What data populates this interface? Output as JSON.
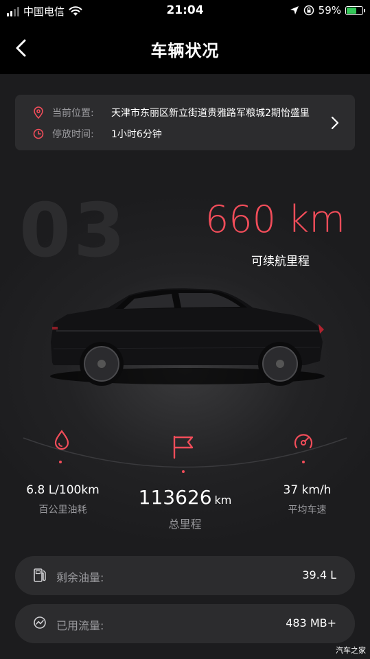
{
  "status_bar": {
    "carrier": "中国电信",
    "time": "21:04",
    "battery": "59%"
  },
  "nav": {
    "title": "车辆状况"
  },
  "location": {
    "position_label": "当前位置:",
    "position_value": "天津市东丽区新立街道贵雅路军粮城2期怡盛里",
    "parked_label": "停放时间:",
    "parked_value": "1小时6分钟"
  },
  "vehicle": {
    "model_watermark": "03",
    "range_value": "660 km",
    "range_label": "可续航里程"
  },
  "stats": {
    "fuel_consumption": {
      "value": "6.8 L/100km",
      "label": "百公里油耗"
    },
    "total_mileage": {
      "value": "113626",
      "unit": "km",
      "label": "总里程"
    },
    "avg_speed": {
      "value": "37 km/h",
      "label": "平均车速"
    }
  },
  "rows": {
    "fuel_remaining": {
      "label": "剩余油量:",
      "value": "39.4 L"
    },
    "data_used": {
      "label": "已用流量:",
      "value": "483 MB+"
    }
  },
  "watermark": "汽车之家",
  "colors": {
    "accent": "#f24d5a",
    "card": "#2c2c2e",
    "muted": "#9a9a9e"
  },
  "icons": [
    "wifi-icon",
    "location-arrow-icon",
    "lock-rotation-icon",
    "battery-icon",
    "back-chevron-icon",
    "map-pin-icon",
    "clock-icon",
    "chevron-right-icon",
    "fuel-drop-icon",
    "flag-icon",
    "speedometer-icon",
    "fuel-pump-icon",
    "data-trend-icon"
  ]
}
